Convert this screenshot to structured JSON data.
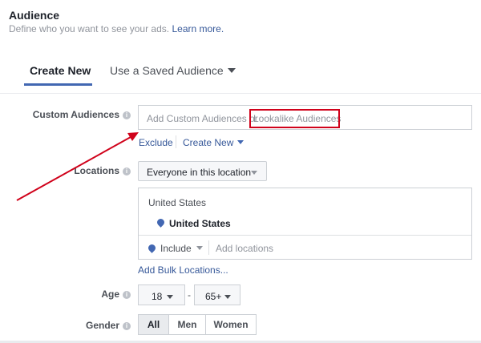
{
  "header": {
    "title": "Audience",
    "subtitle": "Define who you want to see your ads.",
    "learn_more": "Learn more."
  },
  "tabs": {
    "create_new": "Create New",
    "saved": "Use a Saved Audience"
  },
  "custom_audiences": {
    "label": "Custom Audiences",
    "placeholder_prefix": "Add Custom Audiences or",
    "placeholder_highlight": "Lookalike Audiences",
    "exclude": "Exclude",
    "create_new": "Create New"
  },
  "locations": {
    "label": "Locations",
    "dropdown": "Everyone in this location",
    "country_header": "United States",
    "selected": "United States",
    "include": "Include",
    "add_placeholder": "Add locations",
    "bulk_link": "Add Bulk Locations..."
  },
  "age": {
    "label": "Age",
    "min": "18",
    "dash": "-",
    "max": "65+"
  },
  "gender": {
    "label": "Gender",
    "options": [
      "All",
      "Men",
      "Women"
    ],
    "selected": "All"
  },
  "annotation": {
    "color": "#d0021b"
  }
}
